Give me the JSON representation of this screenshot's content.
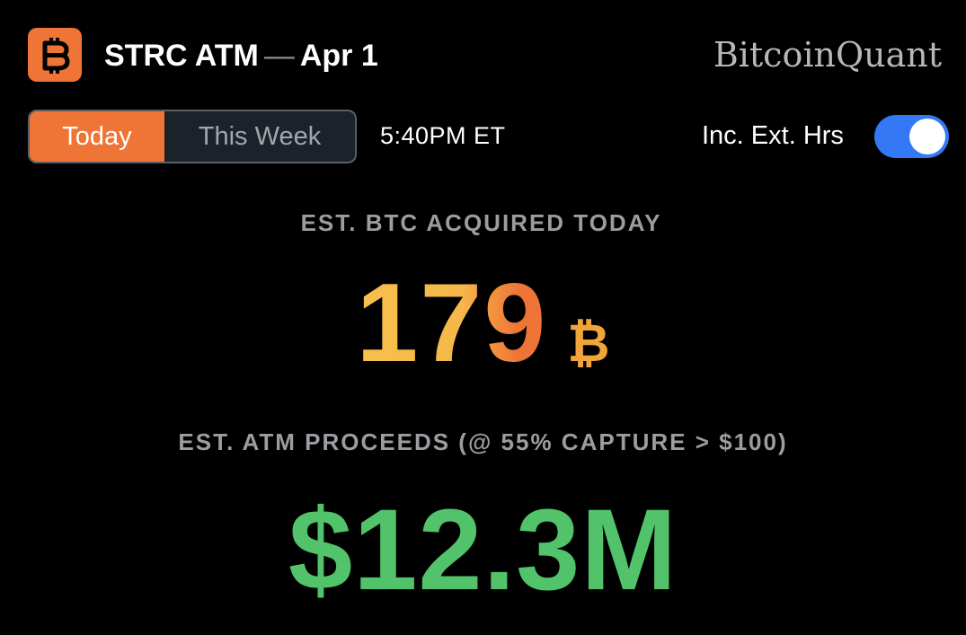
{
  "header": {
    "app_icon": "bitcoin-icon",
    "title": "STRC ATM",
    "separator": "—",
    "date": "Apr 1",
    "brand": "BitcoinQuant"
  },
  "controls": {
    "tabs": [
      {
        "label": "Today",
        "selected": true
      },
      {
        "label": "This Week",
        "selected": false
      }
    ],
    "time": "5:40PM ET",
    "ext_hours_label": "Inc. Ext. Hrs",
    "ext_hours_on": true
  },
  "metrics": {
    "btc_label": "EST. BTC ACQUIRED TODAY",
    "btc_value": "179",
    "btc_unit": "₿",
    "proceeds_label": "EST. ATM PROCEEDS (@ 55% CAPTURE > $100)",
    "proceeds_value": "$12.3M"
  },
  "colors": {
    "accent_orange": "#ee7535",
    "btc_gold": "#f7c04c",
    "proceeds_green": "#52c36a",
    "toggle_blue": "#3478f6",
    "background": "#000000"
  }
}
